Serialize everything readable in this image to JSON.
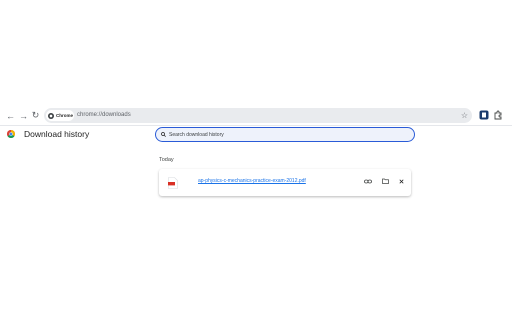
{
  "toolbar": {
    "back_icon": "arrow-left-icon",
    "forward_icon": "arrow-right-icon",
    "reload_icon": "reload-icon",
    "chip_label": "Chrome",
    "url": "chrome://downloads",
    "bookmark_icon": "star-icon"
  },
  "page": {
    "title": "Download history"
  },
  "search": {
    "placeholder": "Search download history"
  },
  "downloads": {
    "date_label": "Today",
    "items": [
      {
        "file_name": "ap-physics-c-mechanics-practice-exam-2012.pdf",
        "file_type_label": "PDF"
      }
    ]
  },
  "colors": {
    "accent": "#1a73e8",
    "search_border": "#2a5bd7",
    "pdf_red": "#d93025"
  }
}
